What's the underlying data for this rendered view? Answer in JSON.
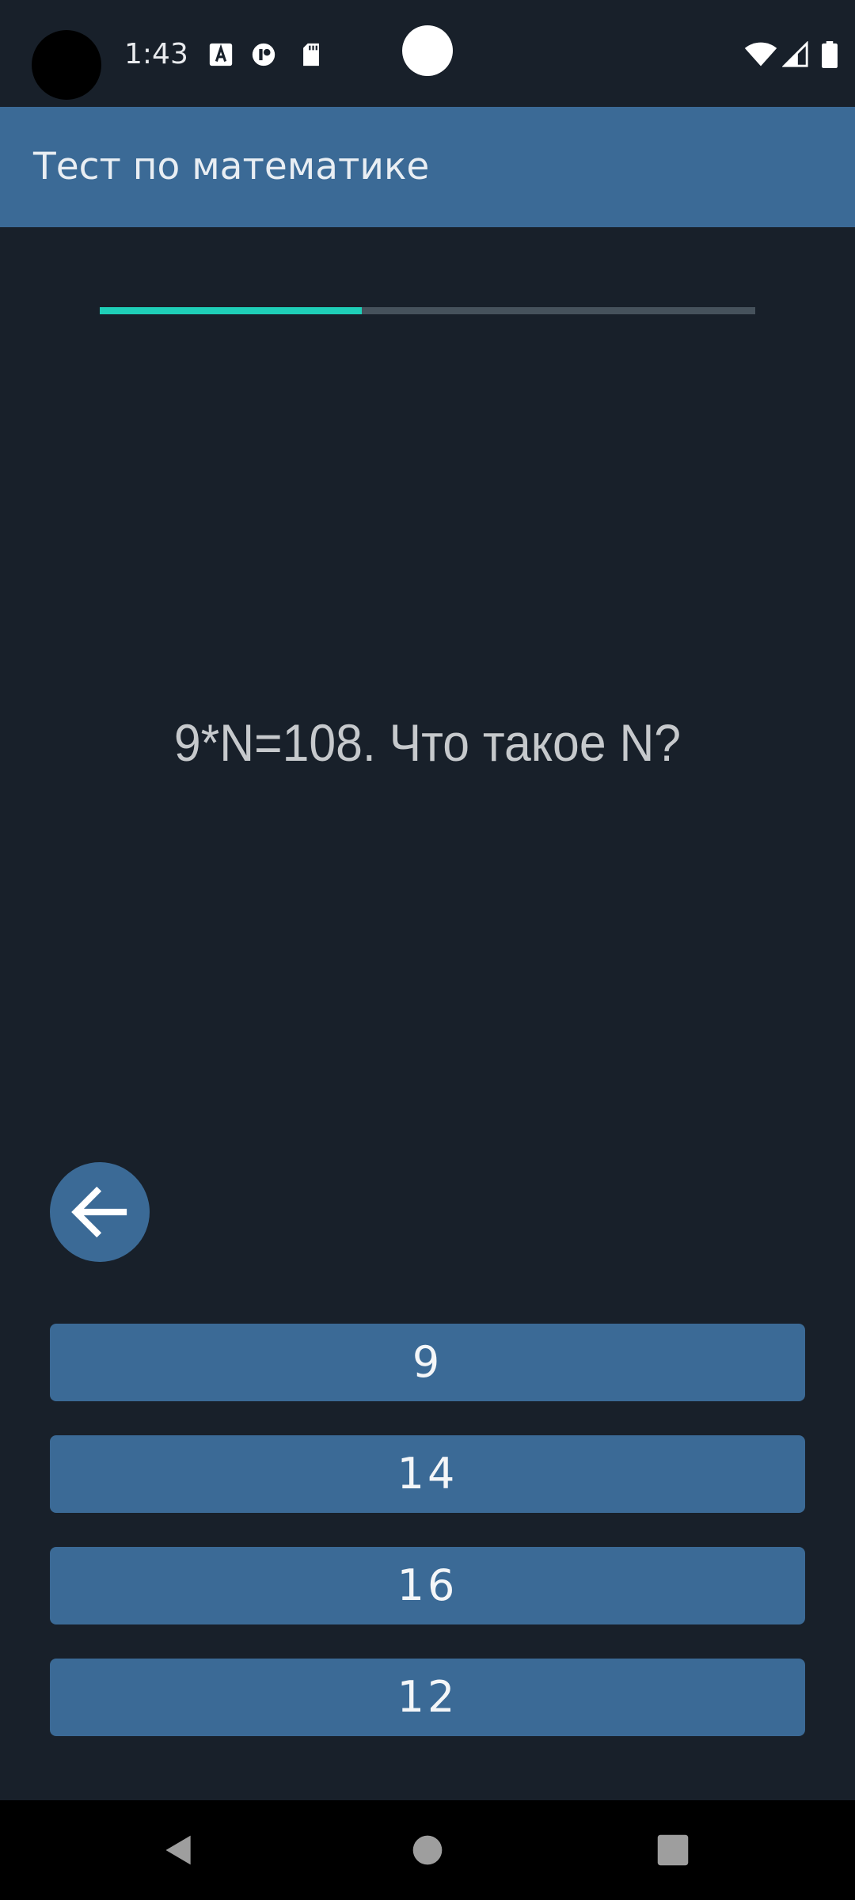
{
  "status_bar": {
    "time": "1:43",
    "left_icons": [
      "text-a-icon",
      "bug-icon",
      "sd-card-icon"
    ],
    "right_icons": [
      "wifi-icon",
      "signal-icon",
      "battery-icon"
    ]
  },
  "app_bar": {
    "title": "Тест по математике"
  },
  "progress": {
    "fraction": 0.4
  },
  "question": {
    "text": "9*N=108. Что такое N?"
  },
  "back_button": {
    "icon": "arrow-left-icon"
  },
  "answers": [
    {
      "label": "9"
    },
    {
      "label": "14"
    },
    {
      "label": "16"
    },
    {
      "label": "12"
    }
  ],
  "nav_bar": {
    "buttons": [
      "back-triangle-icon",
      "home-circle-icon",
      "recents-square-icon"
    ]
  },
  "colors": {
    "background": "#18202a",
    "primary": "#3b6a96",
    "accent": "#1fcfb8",
    "track": "#46525c"
  }
}
